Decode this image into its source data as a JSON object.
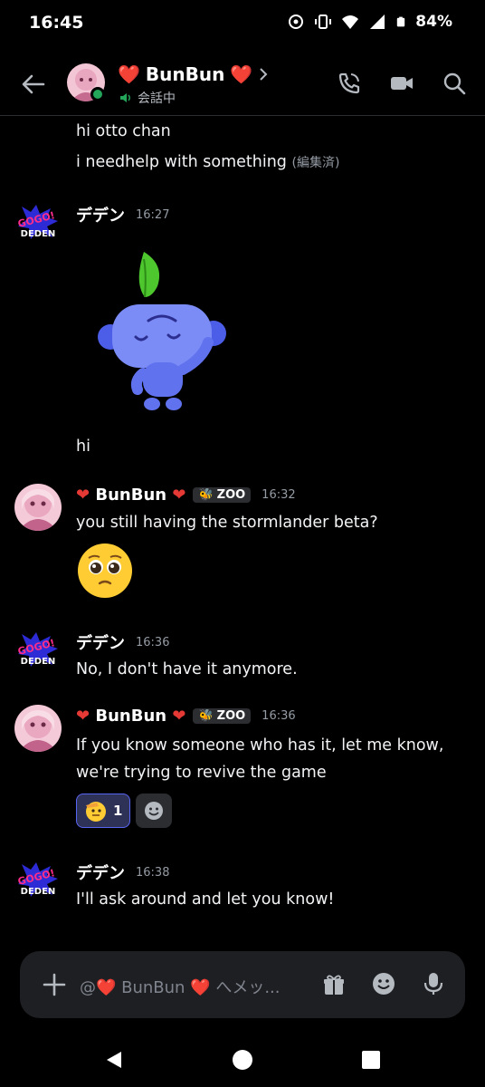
{
  "status_bar": {
    "time": "16:45",
    "battery": "84%",
    "icons": [
      "sync-icon",
      "vibrate-icon",
      "wifi-icon",
      "signal-icon",
      "battery-icon"
    ]
  },
  "header": {
    "name_prefix": "❤️",
    "name": "BunBun",
    "name_suffix": "❤️",
    "status": "会話中",
    "actions": [
      "phone-call-icon",
      "video-call-icon",
      "search-icon"
    ]
  },
  "messages": [
    {
      "text": "hi otto chan"
    },
    {
      "text": "i needhelp with something",
      "edited": "(編集済)"
    },
    {
      "author": "デデン",
      "time": "16:27",
      "text": "hi",
      "sticker": "wumpus-sticker"
    },
    {
      "author": "BunBun",
      "tag": "ZOO",
      "time": "16:32",
      "text": "you still having the stormlander beta?",
      "emoji": "pleading-face"
    },
    {
      "author": "デデン",
      "time": "16:36",
      "text": "No, I don't have it anymore."
    },
    {
      "author": "BunBun",
      "tag": "ZOO",
      "time": "16:36",
      "text_line1": "If you know someone who has it, let me know,",
      "text_line2": "we're trying to revive the game",
      "reaction_count": "1"
    },
    {
      "author": "デデン",
      "time": "16:38",
      "text": "I'll ask around and let you know!"
    }
  ],
  "deden_logo": {
    "line1": "GOGO!",
    "line2": "DEDEN"
  },
  "composer": {
    "placeholder": "@❤️ BunBun ❤️ へメッ..."
  },
  "colors": {
    "accent": "#5865f2",
    "online": "#23a55a",
    "background": "#000000",
    "heart": "#e53935"
  }
}
